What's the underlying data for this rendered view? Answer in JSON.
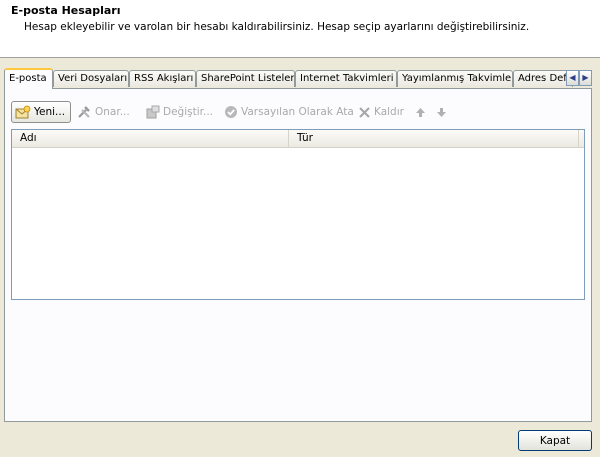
{
  "header": {
    "title": "E-posta Hesapları",
    "subtitle": "Hesap ekleyebilir ve varolan bir hesabı kaldırabilirsiniz. Hesap seçip ayarlarını değiştirebilirsiniz."
  },
  "tabs": [
    {
      "label": "E-posta",
      "active": true
    },
    {
      "label": "Veri Dosyaları"
    },
    {
      "label": "RSS Akışları"
    },
    {
      "label": "SharePoint Listeleri"
    },
    {
      "label": "Internet Takvimleri"
    },
    {
      "label": "Yayımlanmış Takvimler"
    },
    {
      "label": "Adres Defterleri"
    }
  ],
  "tab_scroll": {
    "left": "◀",
    "right": "▶"
  },
  "toolbar": {
    "new_label": "Yeni...",
    "repair_label": "Onar...",
    "change_label": "Değiştir...",
    "default_label": "Varsayılan Olarak Ata",
    "remove_label": "Kaldır"
  },
  "list": {
    "columns": [
      "Adı",
      "Tür"
    ]
  },
  "footer": {
    "close_label": "Kapat"
  },
  "colors": {
    "active_tab_accent": "#ffc83c",
    "disabled_text": "#a9a9a9",
    "border": "#7f9db9"
  }
}
